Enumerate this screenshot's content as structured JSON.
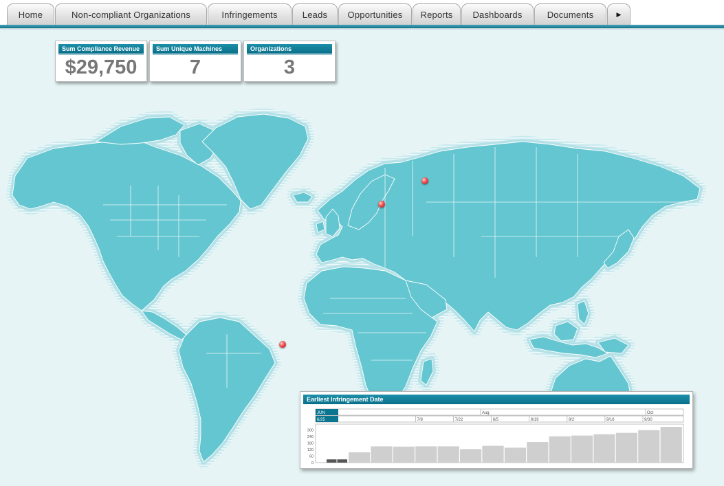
{
  "nav": {
    "tabs": [
      {
        "label": "Home"
      },
      {
        "label": "Non-compliant Organizations"
      },
      {
        "label": "Infringements"
      },
      {
        "label": "Leads"
      },
      {
        "label": "Opportunities"
      },
      {
        "label": "Reports"
      },
      {
        "label": "Dashboards"
      },
      {
        "label": "Documents"
      }
    ],
    "more_icon": "right-triangle-icon"
  },
  "kpis": [
    {
      "label": "Sum Compliance Revenue",
      "value": "$29,750"
    },
    {
      "label": "Sum Unique Machines",
      "value": "7"
    },
    {
      "label": "Organizations",
      "value": "3"
    }
  ],
  "map": {
    "markers": [
      {
        "name": "russia",
        "lon": 37.6,
        "lat": 55.8
      },
      {
        "name": "central-europe",
        "lon": 14.5,
        "lat": 46.0
      },
      {
        "name": "brazil",
        "lon": -38.5,
        "lat": -12.9
      }
    ],
    "colors": {
      "land": "#64c6d0",
      "ocean": "#e6f4f5",
      "glow": "#b4e1e7"
    }
  },
  "timeline": {
    "title": "Earliest Infringement Date",
    "months": [
      {
        "label": "JUN",
        "start": "2012-06-01"
      },
      {
        "label": "Aug",
        "start": "2012-08-01"
      },
      {
        "label": "Oct",
        "start": "2012-10-01"
      }
    ],
    "weeks": [
      "6/25",
      "7/8",
      "7/22",
      "8/5",
      "8/19",
      "9/2",
      "9/16",
      "9/30"
    ],
    "selected_month": "JUN",
    "selected_week": "6/25",
    "colors": {
      "selected": "#0b7590",
      "bar": "#cfcfcf",
      "bar_selected": "#555555"
    }
  },
  "chart_data": {
    "type": "bar",
    "title": "Earliest Infringement Date",
    "xlabel": "",
    "ylabel": "",
    "ylim": [
      0,
      330
    ],
    "yticks": [
      0,
      60,
      120,
      180,
      240,
      300
    ],
    "categories": [
      "6/25",
      "7/1",
      "7/8",
      "7/15",
      "7/22",
      "7/29",
      "8/5",
      "8/12",
      "8/19",
      "8/26",
      "9/2",
      "9/9",
      "9/16",
      "9/23",
      "9/30",
      "10/7"
    ],
    "values": [
      30,
      95,
      150,
      148,
      150,
      150,
      125,
      155,
      138,
      190,
      243,
      250,
      262,
      275,
      300,
      330
    ],
    "selected_index": 0,
    "grid": false,
    "legend": "none"
  }
}
